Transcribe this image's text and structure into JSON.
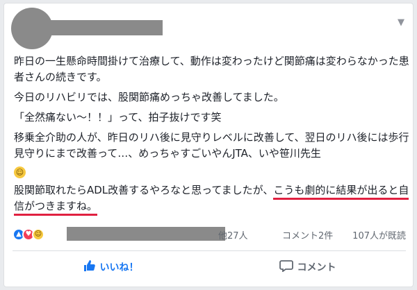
{
  "post": {
    "paragraphs": [
      "昨日の一生懸命時間掛けて治療して、動作は変わったけど関節痛は変わらなかった患者さんの続きです。",
      "今日のリハビリでは、股関節痛めっちゃ改善してました。",
      "「全然痛ない〜！！」って、拍子抜けです笑",
      "移乗全介助の人が、昨日のリハ後に見守りレベルに改善して、翌日のリハ後には歩行見守りにまで改善って…、めっちゃすごいやんJTA、いや笹川先生"
    ],
    "last_paragraph_plain": "股関節取れたらADL改善するやろなと思ってましたが、",
    "last_paragraph_highlight": "こうも劇的に結果が出ると自信がつきますね。",
    "emoji": "😄"
  },
  "reactions": {
    "others": "他27人",
    "comments": "コメント2件",
    "seen": "107人が既読",
    "icons": [
      "like-icon",
      "love-icon",
      "haha-icon"
    ]
  },
  "actions": {
    "like_label": "いいね！",
    "comment_label": "コメント"
  },
  "colors": {
    "accent": "#1877f2",
    "highlight_underline": "#e02040",
    "redaction": "#8a8a8a"
  }
}
